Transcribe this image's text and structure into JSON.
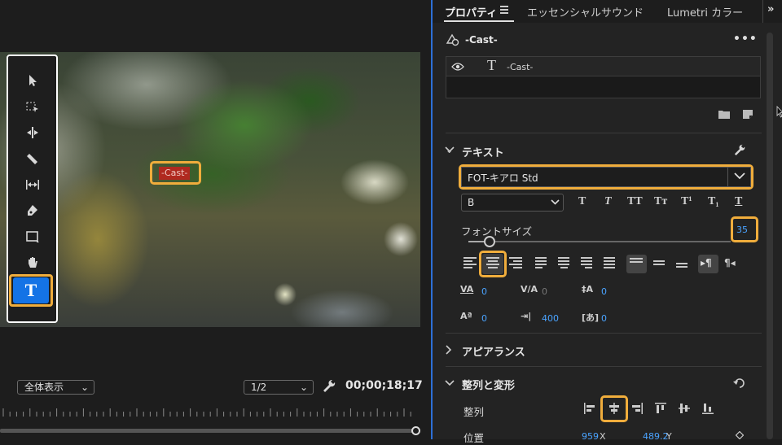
{
  "monitor": {
    "fit_dropdown": "全体表示",
    "resolution_dropdown": "1/2",
    "timecode": "00;00;18;17",
    "title_overlay": "-Cast-"
  },
  "tools": [
    {
      "name": "selection-tool",
      "icon": "arrow-icon"
    },
    {
      "name": "track-select-tool",
      "icon": "track-select-icon"
    },
    {
      "name": "ripple-edit-tool",
      "icon": "ripple-icon"
    },
    {
      "name": "razor-tool",
      "icon": "razor-icon"
    },
    {
      "name": "slip-tool",
      "icon": "slip-icon"
    },
    {
      "name": "pen-tool",
      "icon": "pen-icon"
    },
    {
      "name": "rectangle-tool",
      "icon": "rectangle-icon"
    },
    {
      "name": "hand-tool",
      "icon": "hand-icon"
    },
    {
      "name": "type-tool",
      "icon": "type-icon",
      "label": "T",
      "active": true
    }
  ],
  "tabs": {
    "properties": "プロパティ",
    "essential_sound": "エッセンシャルサウンド",
    "lumetri_color": "Lumetri カラー"
  },
  "clip": {
    "name": "-Cast-",
    "layer_name": "-Cast-",
    "layer_type_glyph": "T"
  },
  "text_section": {
    "title": "テキスト",
    "font": "FOT-キアロ Std",
    "style": "B",
    "font_size_label": "フォントサイズ",
    "font_size": "35",
    "font_size_fraction": 0.08,
    "typo_buttons": [
      "T",
      "T",
      "TT",
      "Tт",
      "T¹",
      "T₁",
      "T"
    ],
    "tracking": "0",
    "kerning": "0",
    "leading": "0",
    "baseline_shift": "0",
    "tab_width": "400",
    "tsume": "0"
  },
  "appearance": {
    "title": "アピアランス"
  },
  "align_transform": {
    "title": "整列と変形",
    "align_label": "整列",
    "position_label": "位置",
    "pos_x": "959",
    "pos_x_label": "X",
    "pos_y": "489.2",
    "pos_y_label": "Y"
  },
  "colors": {
    "highlight": "#f0ad3c",
    "accent_blue": "#1473e6",
    "value_blue": "#4aa3ff",
    "title_red": "#b0291f"
  }
}
